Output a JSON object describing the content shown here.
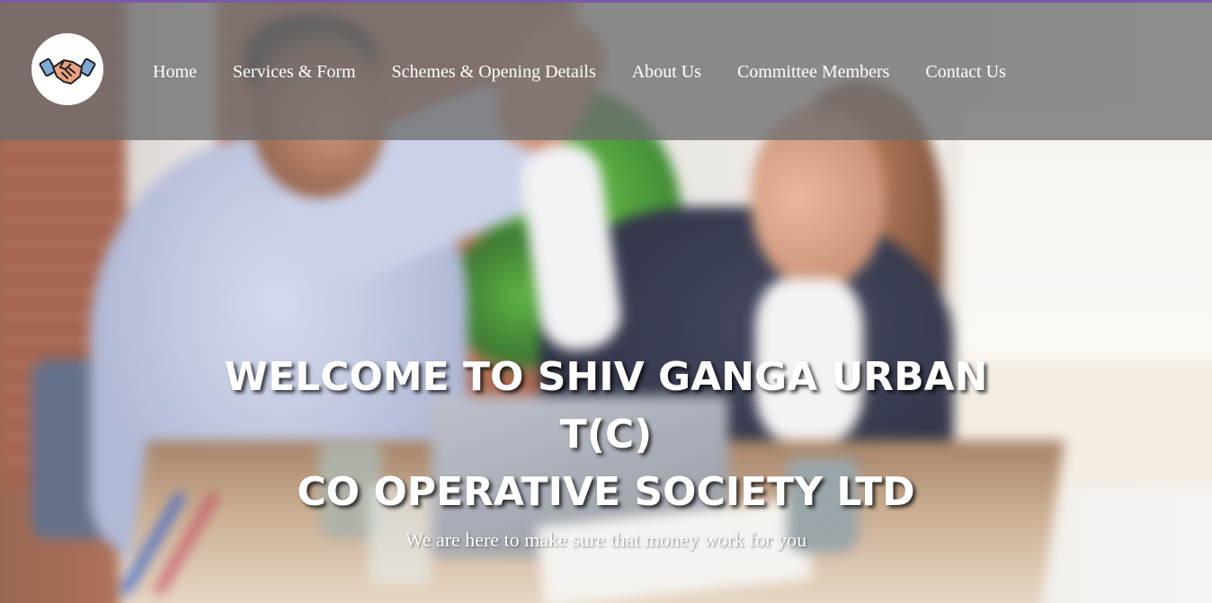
{
  "header": {
    "logo_icon": "handshake-icon",
    "nav_items": [
      {
        "label": "Home"
      },
      {
        "label": "Services & Form"
      },
      {
        "label": "Schemes & Opening Details"
      },
      {
        "label": "About Us"
      },
      {
        "label": "Committee Members"
      },
      {
        "label": "Contact Us"
      }
    ]
  },
  "hero": {
    "title_line1": "WELCOME TO SHIV GANGA URBAN T(C)",
    "title_line2": "CO OPERATIVE SOCIETY LTD",
    "subtitle": "We are here to make sure that money work for you",
    "background_image": "blurred-office-high-five-photo"
  },
  "colors": {
    "header_overlay": "#6e6e70",
    "nav_text": "#ffffff",
    "hero_text": "#ffffff",
    "top_accent": "#7a5aa8"
  }
}
